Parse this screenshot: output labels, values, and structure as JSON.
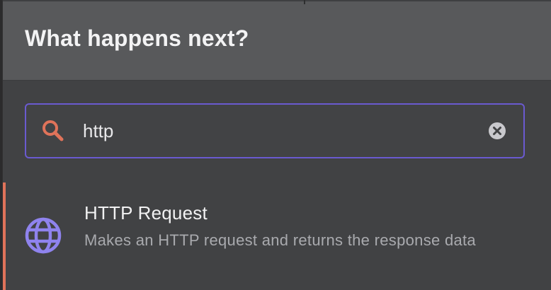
{
  "header": {
    "title": "What happens next?"
  },
  "search": {
    "value": "http",
    "icon": "search-icon",
    "clear_icon": "clear-icon",
    "accent_color": "#6a5ad0",
    "icon_color": "#e0735a"
  },
  "results": [
    {
      "title": "HTTP Request",
      "description": "Makes an HTTP request and returns the response data",
      "icon": "globe-icon",
      "icon_color": "#8f83ee",
      "selected": true,
      "indicator_color": "#e0735a"
    }
  ]
}
